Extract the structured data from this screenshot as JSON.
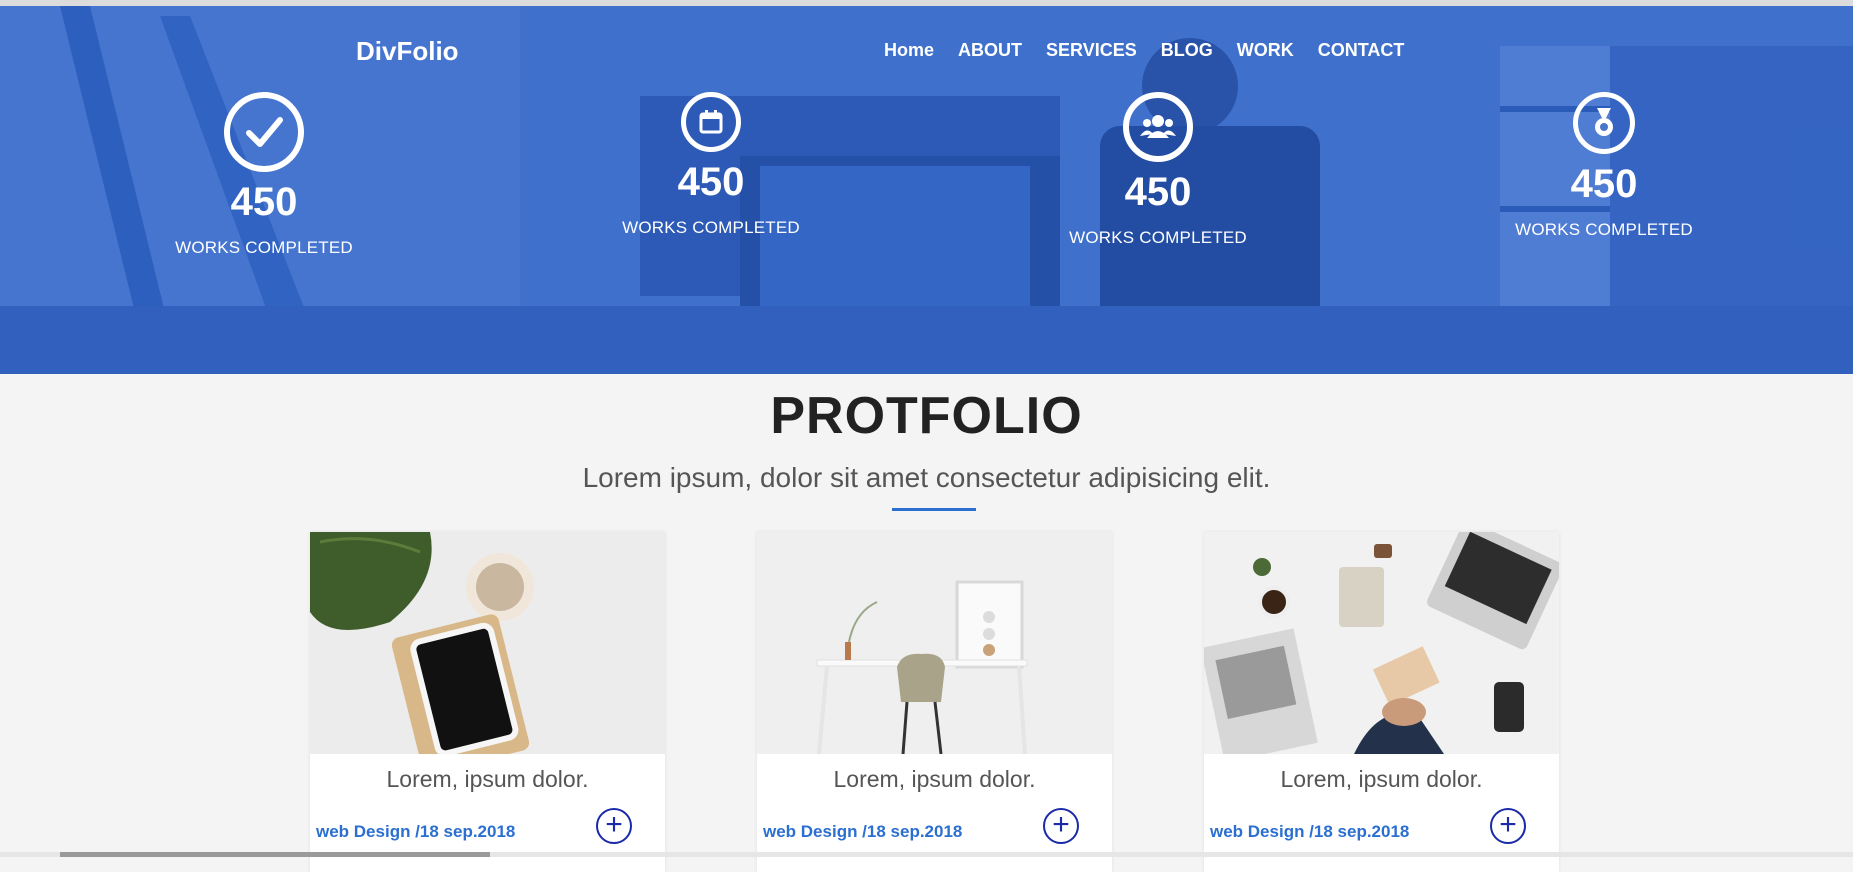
{
  "brand": "DivFolio",
  "nav": [
    "Home",
    "ABOUT",
    "SERVICES",
    "BLOG",
    "WORK",
    "CONTACT"
  ],
  "stats": [
    {
      "icon": "check-icon",
      "value": "450",
      "label": "WORKS COMPLETED"
    },
    {
      "icon": "calendar-icon",
      "value": "450",
      "label": "WORKS COMPLETED"
    },
    {
      "icon": "users-icon",
      "value": "450",
      "label": "WORKS COMPLETED"
    },
    {
      "icon": "medal-icon",
      "value": "450",
      "label": "WORKS COMPLETED"
    }
  ],
  "portfolio": {
    "title": "PROTFOLIO",
    "subtitle": "Lorem ipsum, dolor sit amet consectetur adipisicing elit."
  },
  "cards": [
    {
      "title": "Lorem, ipsum dolor.",
      "meta": "web Design /18 sep.2018",
      "plus": "+"
    },
    {
      "title": "Lorem, ipsum dolor.",
      "meta": "web Design /18 sep.2018",
      "plus": "+"
    },
    {
      "title": "Lorem, ipsum dolor.",
      "meta": "web Design /18 sep.2018",
      "plus": "+"
    }
  ],
  "colors": {
    "hero": "#4a76c9",
    "accent": "#2b6fd0",
    "plusIcon": "#1a2aa8"
  }
}
